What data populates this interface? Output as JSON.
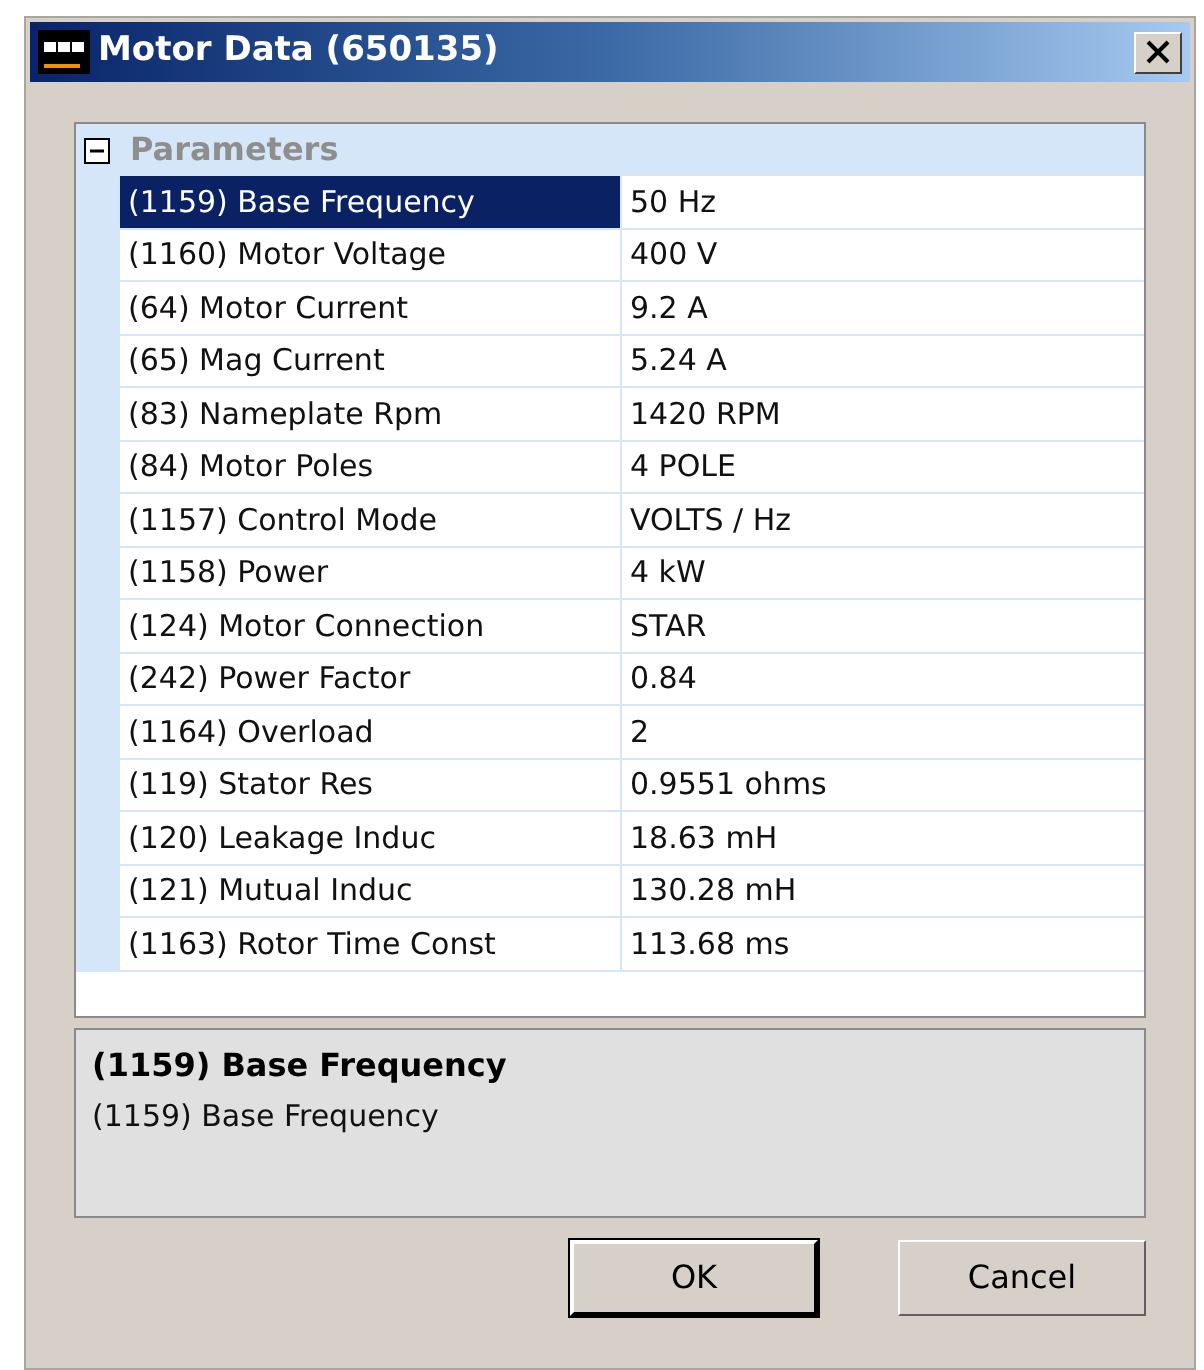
{
  "window": {
    "title": "Motor Data (650135)"
  },
  "category": {
    "label": "Parameters",
    "expanded": true
  },
  "rows": [
    {
      "name": "(1159) Base Frequency",
      "value": "50 Hz",
      "selected": true
    },
    {
      "name": "(1160) Motor Voltage",
      "value": "400 V",
      "selected": false
    },
    {
      "name": "(64) Motor Current",
      "value": "9.2 A",
      "selected": false
    },
    {
      "name": "(65) Mag Current",
      "value": "5.24 A",
      "selected": false
    },
    {
      "name": "(83) Nameplate Rpm",
      "value": "1420 RPM",
      "selected": false
    },
    {
      "name": "(84) Motor Poles",
      "value": "4 POLE",
      "selected": false
    },
    {
      "name": "(1157) Control Mode",
      "value": "VOLTS / Hz",
      "selected": false
    },
    {
      "name": "(1158) Power",
      "value": "4 kW",
      "selected": false
    },
    {
      "name": "(124) Motor Connection",
      "value": "STAR",
      "selected": false
    },
    {
      "name": "(242) Power Factor",
      "value": "0.84",
      "selected": false
    },
    {
      "name": "(1164) Overload",
      "value": "2",
      "selected": false
    },
    {
      "name": "(119) Stator Res",
      "value": "0.9551 ohms",
      "selected": false
    },
    {
      "name": "(120) Leakage Induc",
      "value": "18.63 mH",
      "selected": false
    },
    {
      "name": "(121) Mutual Induc",
      "value": "130.28 mH",
      "selected": false
    },
    {
      "name": "(1163) Rotor Time Const",
      "value": "113.68 ms",
      "selected": false
    }
  ],
  "description": {
    "title": "(1159) Base Frequency",
    "text": "(1159) Base Frequency"
  },
  "buttons": [
    "OK",
    "Cancel"
  ]
}
